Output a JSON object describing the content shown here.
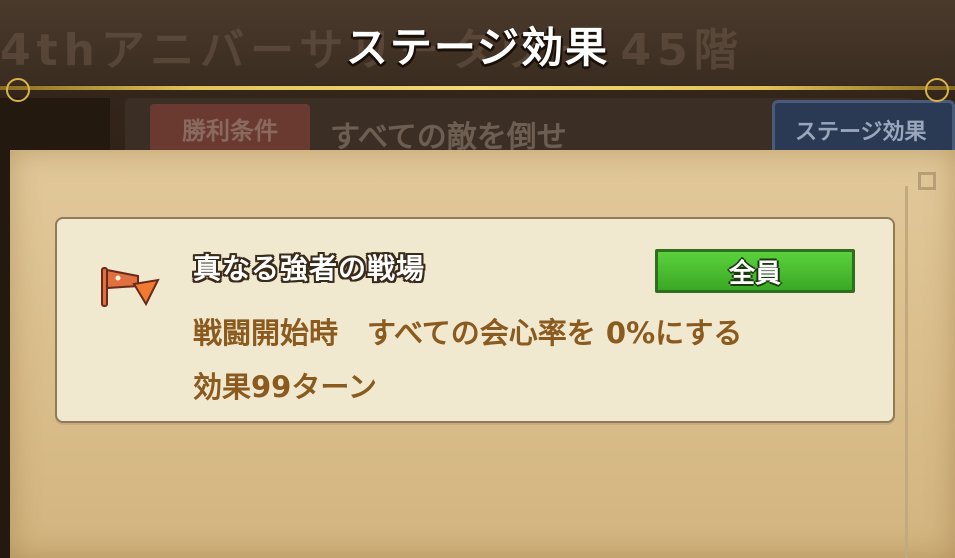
{
  "background": {
    "floor_text": "4thアニバーサリータワー 45階",
    "condition_label": "勝利条件",
    "condition_text": "すべての敵を倒せ",
    "stage_effect_button": "ステージ効果"
  },
  "modal": {
    "title": "ステージ効果"
  },
  "effect": {
    "icon": "flag-icon",
    "name": "真なる強者の戦場",
    "target": "全員",
    "description_line1": "戦闘開始時　すべての会心率を 0%にする",
    "description_line2": "効果99ターン"
  },
  "colors": {
    "target_badge": "#4cc032",
    "description_text": "#8a5a1e",
    "parchment": "#dcc28f"
  }
}
